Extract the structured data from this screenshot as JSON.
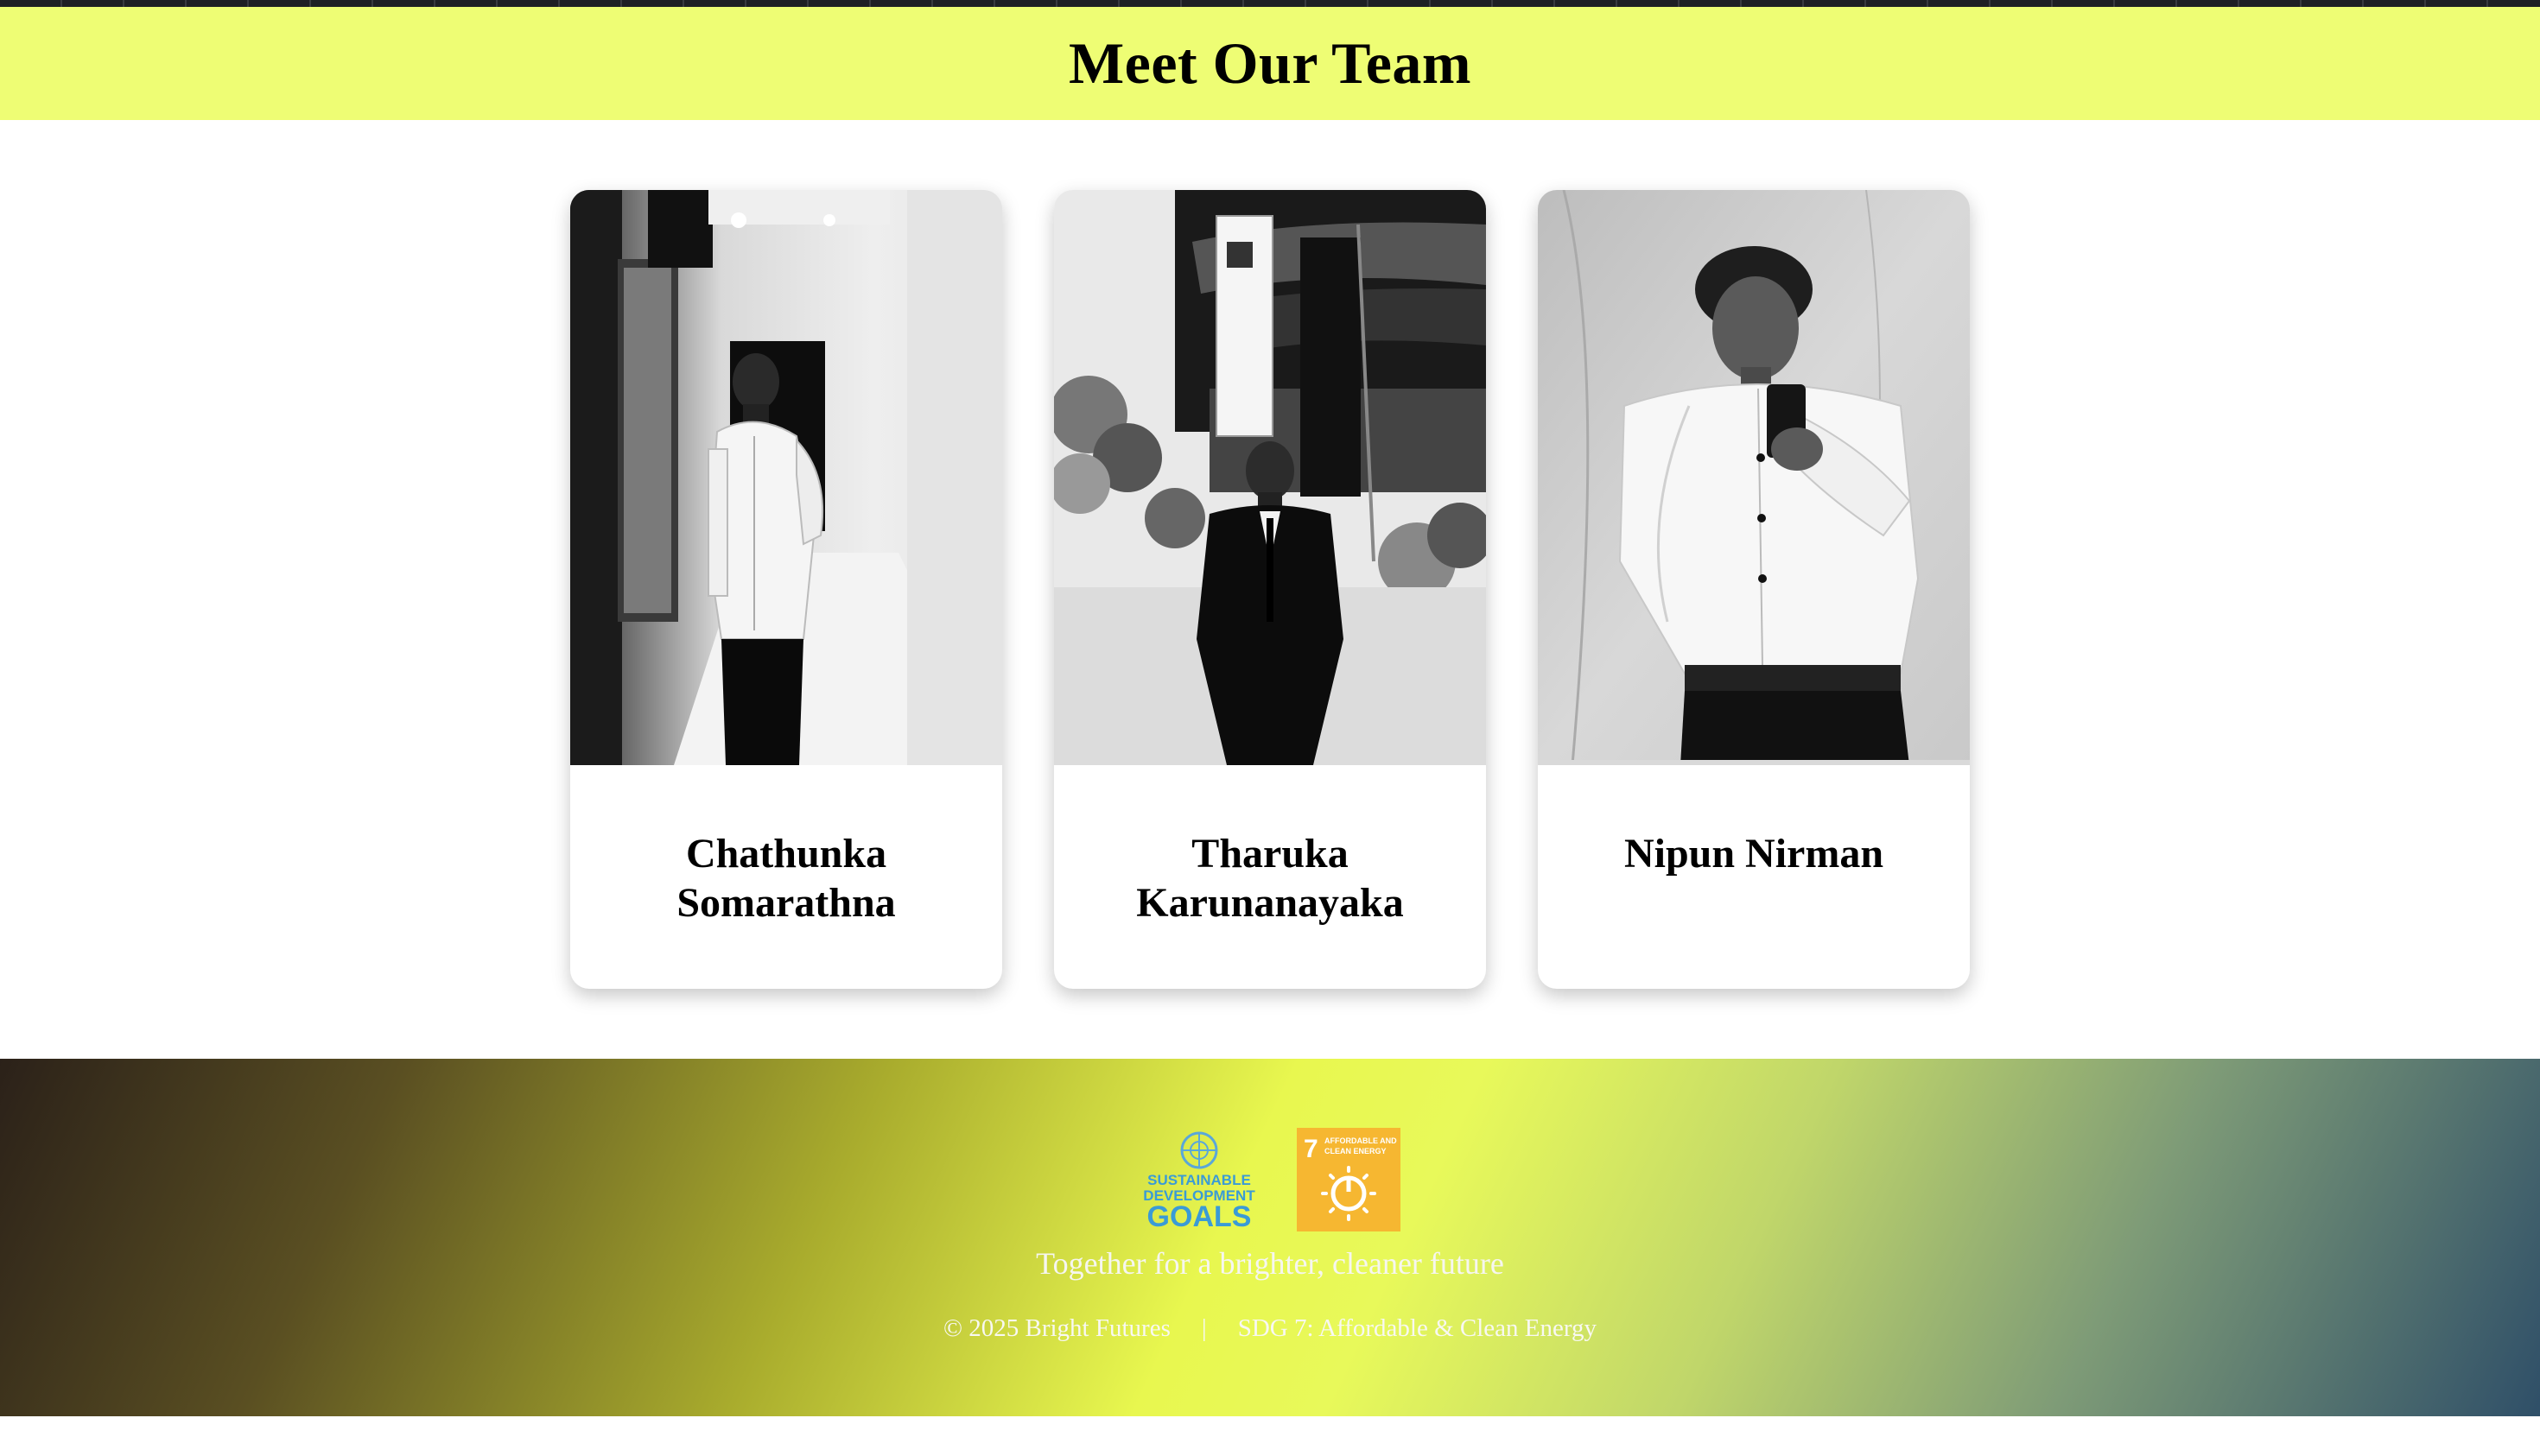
{
  "header": {
    "title": "Meet Our Team"
  },
  "team": {
    "members": [
      {
        "name": "Chathunka Somarathna",
        "photo_icon": "portrait-photo"
      },
      {
        "name": "Tharuka Karunanayaka",
        "photo_icon": "portrait-photo"
      },
      {
        "name": "Nipun Nirman",
        "photo_icon": "portrait-photo"
      }
    ]
  },
  "footer": {
    "logos": {
      "sdg_logo_text": "SUSTAINABLE DEVELOPMENT GOALS",
      "sdg7_number": "7",
      "sdg7_text": "AFFORDABLE AND CLEAN ENERGY"
    },
    "tagline": "Together for a brighter, cleaner future",
    "copyright": "© 2025 Bright Futures",
    "separator": "|",
    "sdg_label": "SDG 7: Affordable & Clean Energy"
  },
  "colors": {
    "header_bg": "#eefd74",
    "sdg7_orange": "#f6b731",
    "sdg_blue": "#3a9bd6"
  }
}
